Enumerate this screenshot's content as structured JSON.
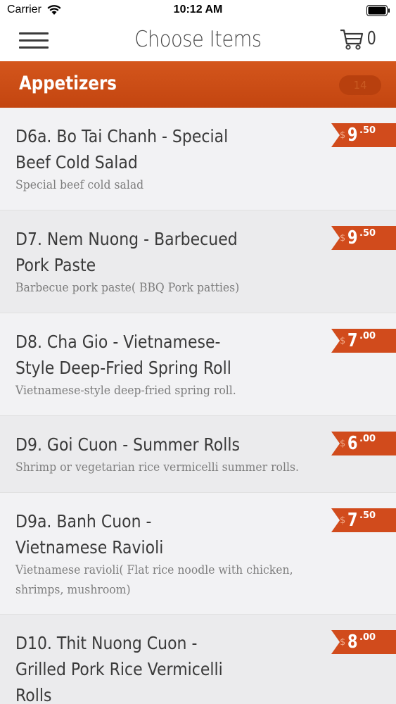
{
  "status_bar": {
    "carrier": "Carrier",
    "time": "10:12 AM"
  },
  "nav": {
    "title": "Choose Items",
    "cart_count": "0"
  },
  "category": {
    "title": "Appetizers",
    "count": "14"
  },
  "colors": {
    "accent": "#c94d16",
    "price_tag": "#d14b1c"
  },
  "items": [
    {
      "name": "D6a. Bo Tai Chanh - Special Beef Cold Salad",
      "description": "Special beef cold salad",
      "price_symbol": "$",
      "price_dollars": "9",
      "price_cents": ".50"
    },
    {
      "name": "D7. Nem Nuong - Barbecued Pork Paste",
      "description": "Barbecue pork paste( BBQ Pork patties)",
      "price_symbol": "$",
      "price_dollars": "9",
      "price_cents": ".50"
    },
    {
      "name": "D8. Cha Gio - Vietnamese-Style Deep-Fried Spring Roll",
      "description": "Vietnamese-style deep-fried spring roll.",
      "price_symbol": "$",
      "price_dollars": "7",
      "price_cents": ".00"
    },
    {
      "name": "D9. Goi Cuon - Summer Rolls",
      "description": "Shrimp or vegetarian rice vermicelli summer rolls.",
      "price_symbol": "$",
      "price_dollars": "6",
      "price_cents": ".00"
    },
    {
      "name": "D9a. Banh Cuon - Vietnamese Ravioli",
      "description": "Vietnamese ravioli( Flat rice noodle with chicken, shrimps, mushroom)",
      "price_symbol": "$",
      "price_dollars": "7",
      "price_cents": ".50"
    },
    {
      "name": "D10. Thit Nuong Cuon - Grilled Pork Rice Vermicelli Rolls",
      "description": "",
      "price_symbol": "$",
      "price_dollars": "8",
      "price_cents": ".00"
    }
  ]
}
